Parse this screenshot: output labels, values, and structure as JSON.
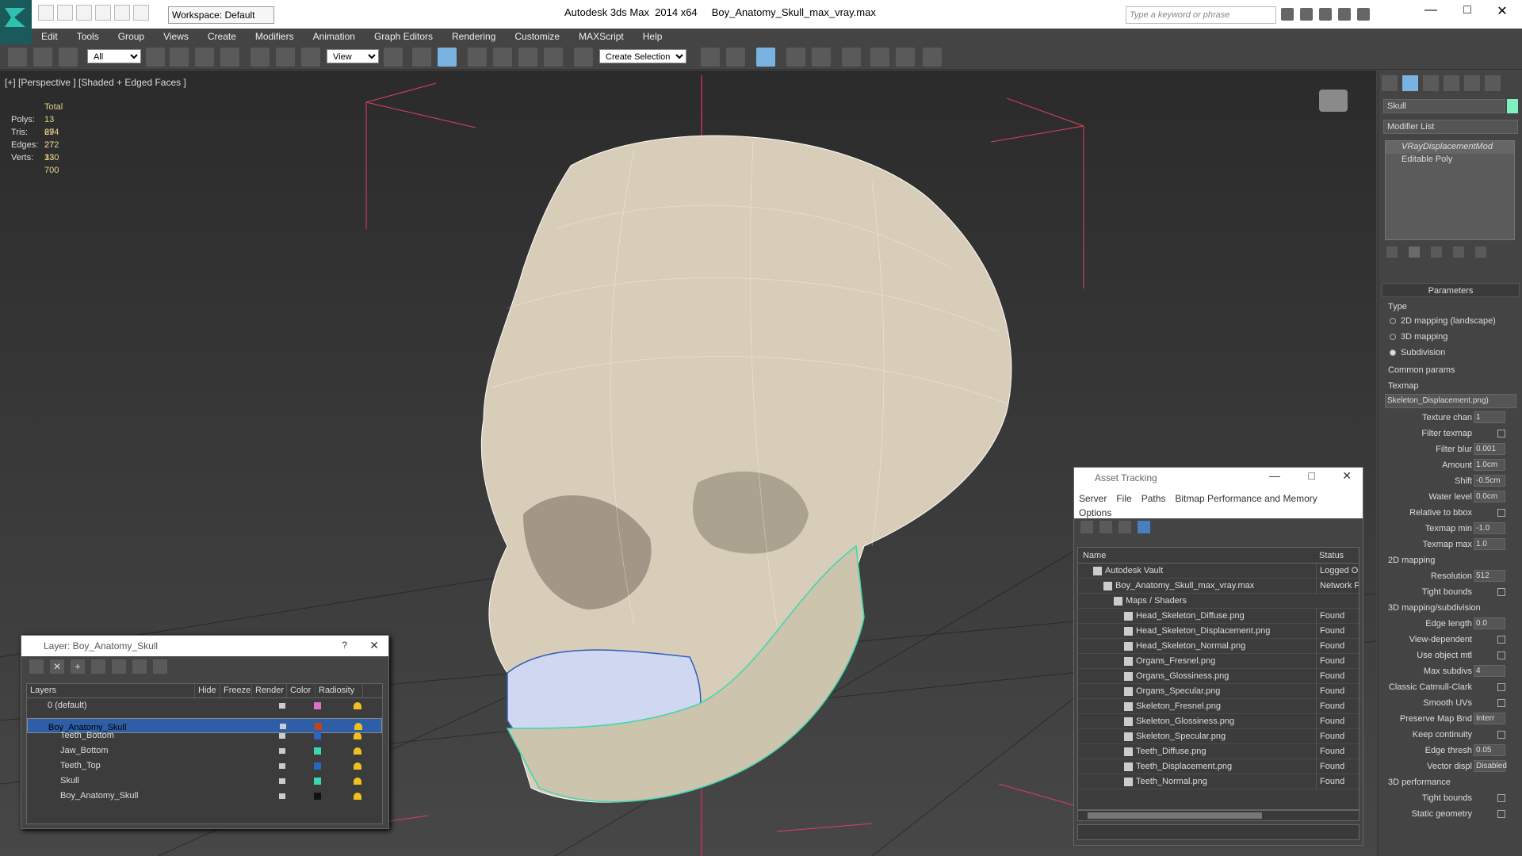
{
  "app": {
    "title": "Autodesk 3ds Max  2014 x64     Boy_Anatomy_Skull_max_vray.max",
    "workspace": "Workspace: Default",
    "search_placeholder": "Type a keyword or phrase"
  },
  "menu": [
    "Edit",
    "Tools",
    "Group",
    "Views",
    "Create",
    "Modifiers",
    "Animation",
    "Graph Editors",
    "Rendering",
    "Customize",
    "MAXScript",
    "Help"
  ],
  "toolbar": {
    "filter": "All",
    "ref_coord": "View",
    "selection_set": "Create Selection Se"
  },
  "viewport": {
    "label": "[+] [Perspective ] [Shaded + Edged Faces ]",
    "stats_header": "Total",
    "stats": [
      {
        "k": "Polys:",
        "v": "13 694"
      },
      {
        "k": "Tris:",
        "v": "27 272"
      },
      {
        "k": "Edges:",
        "v": "27 330"
      },
      {
        "k": "Verts:",
        "v": "13 700"
      }
    ]
  },
  "command_panel": {
    "object_name": "Skull",
    "object_color": "#7ff0c0",
    "modifier_list": "Modifier List",
    "stack": [
      "VRayDisplacementMod",
      "Editable Poly"
    ],
    "params_title": "Parameters",
    "type_label": "Type",
    "type_options": [
      "2D mapping (landscape)",
      "3D mapping",
      "Subdivision"
    ],
    "common_params": "Common params",
    "texmap_label": "Texmap",
    "texmap_value": "Skeleton_Displacement.png)",
    "texture_chan": {
      "label": "Texture chan",
      "value": "1"
    },
    "filter_texmap": "Filter texmap",
    "filter_blur": {
      "label": "Filter blur",
      "value": "0.001"
    },
    "amount": {
      "label": "Amount",
      "value": "1.0cm"
    },
    "shift": {
      "label": "Shift",
      "value": "-0.5cm"
    },
    "water_level": {
      "label": "Water level",
      "value": "0.0cm"
    },
    "relative_bbox": "Relative to bbox",
    "texmap_min": {
      "label": "Texmap min",
      "value": "-1.0"
    },
    "texmap_max": {
      "label": "Texmap max",
      "value": "1.0"
    },
    "mapping2d": "2D mapping",
    "resolution": {
      "label": "Resolution",
      "value": "512"
    },
    "tight_bounds": "Tight bounds",
    "mapping3d": "3D mapping/subdivision",
    "edge_length": {
      "label": "Edge length",
      "value": "0.0"
    },
    "view_dependent": "View-dependent",
    "use_object_mtl": "Use object mtl",
    "max_subdivs": {
      "label": "Max subdivs",
      "value": "4"
    },
    "catmull": "Classic Catmull-Clark",
    "smooth_uvs": "Smooth UVs",
    "preserve_map": {
      "label": "Preserve Map Bnd",
      "value": "Interr"
    },
    "keep_continuity": "Keep continuity",
    "edge_thresh": {
      "label": "Edge thresh",
      "value": "0.05"
    },
    "vector_displ": {
      "label": "Vector displ",
      "value": "Disabled"
    },
    "perf": "3D performance",
    "tight_bounds2": "Tight bounds",
    "static_geo": "Static geometry"
  },
  "layer_window": {
    "title": "Layer: Boy_Anatomy_Skull",
    "columns": [
      "Layers",
      "Hide",
      "Freeze",
      "Render",
      "Color",
      "Radiosity"
    ],
    "rows": [
      {
        "name": "0 (default)",
        "color": "#e06ec8",
        "indent": 1
      },
      {
        "name": "Boy_Anatomy_Skull",
        "color": "#c0441a",
        "indent": 1
      },
      {
        "name": "Teeth_Bottom",
        "color": "#2a66c0",
        "indent": 2
      },
      {
        "name": "Jaw_Bottom",
        "color": "#3ad8b0",
        "indent": 2
      },
      {
        "name": "Teeth_Top",
        "color": "#2a66c0",
        "indent": 2
      },
      {
        "name": "Skull",
        "color": "#3ad8b0",
        "indent": 2
      },
      {
        "name": "Boy_Anatomy_Skull",
        "color": "#111111",
        "indent": 2
      }
    ]
  },
  "asset_window": {
    "title": "Asset Tracking",
    "menu": [
      "Server",
      "File",
      "Paths",
      "Bitmap Performance and Memory",
      "Options"
    ],
    "col_name": "Name",
    "col_status": "Status",
    "rows": [
      {
        "name": "Autodesk Vault",
        "status": "Logged Ou",
        "indent": 1
      },
      {
        "name": "Boy_Anatomy_Skull_max_vray.max",
        "status": "Network Pa",
        "indent": 2
      },
      {
        "name": "Maps / Shaders",
        "status": "",
        "indent": 3
      },
      {
        "name": "Head_Skeleton_Diffuse.png",
        "status": "Found",
        "indent": 4
      },
      {
        "name": "Head_Skeleton_Displacement.png",
        "status": "Found",
        "indent": 4
      },
      {
        "name": "Head_Skeleton_Normal.png",
        "status": "Found",
        "indent": 4
      },
      {
        "name": "Organs_Fresnel.png",
        "status": "Found",
        "indent": 4
      },
      {
        "name": "Organs_Glossiness.png",
        "status": "Found",
        "indent": 4
      },
      {
        "name": "Organs_Specular.png",
        "status": "Found",
        "indent": 4
      },
      {
        "name": "Skeleton_Fresnel.png",
        "status": "Found",
        "indent": 4
      },
      {
        "name": "Skeleton_Glossiness.png",
        "status": "Found",
        "indent": 4
      },
      {
        "name": "Skeleton_Specular.png",
        "status": "Found",
        "indent": 4
      },
      {
        "name": "Teeth_Diffuse.png",
        "status": "Found",
        "indent": 4
      },
      {
        "name": "Teeth_Displacement.png",
        "status": "Found",
        "indent": 4
      },
      {
        "name": "Teeth_Normal.png",
        "status": "Found",
        "indent": 4
      }
    ]
  }
}
